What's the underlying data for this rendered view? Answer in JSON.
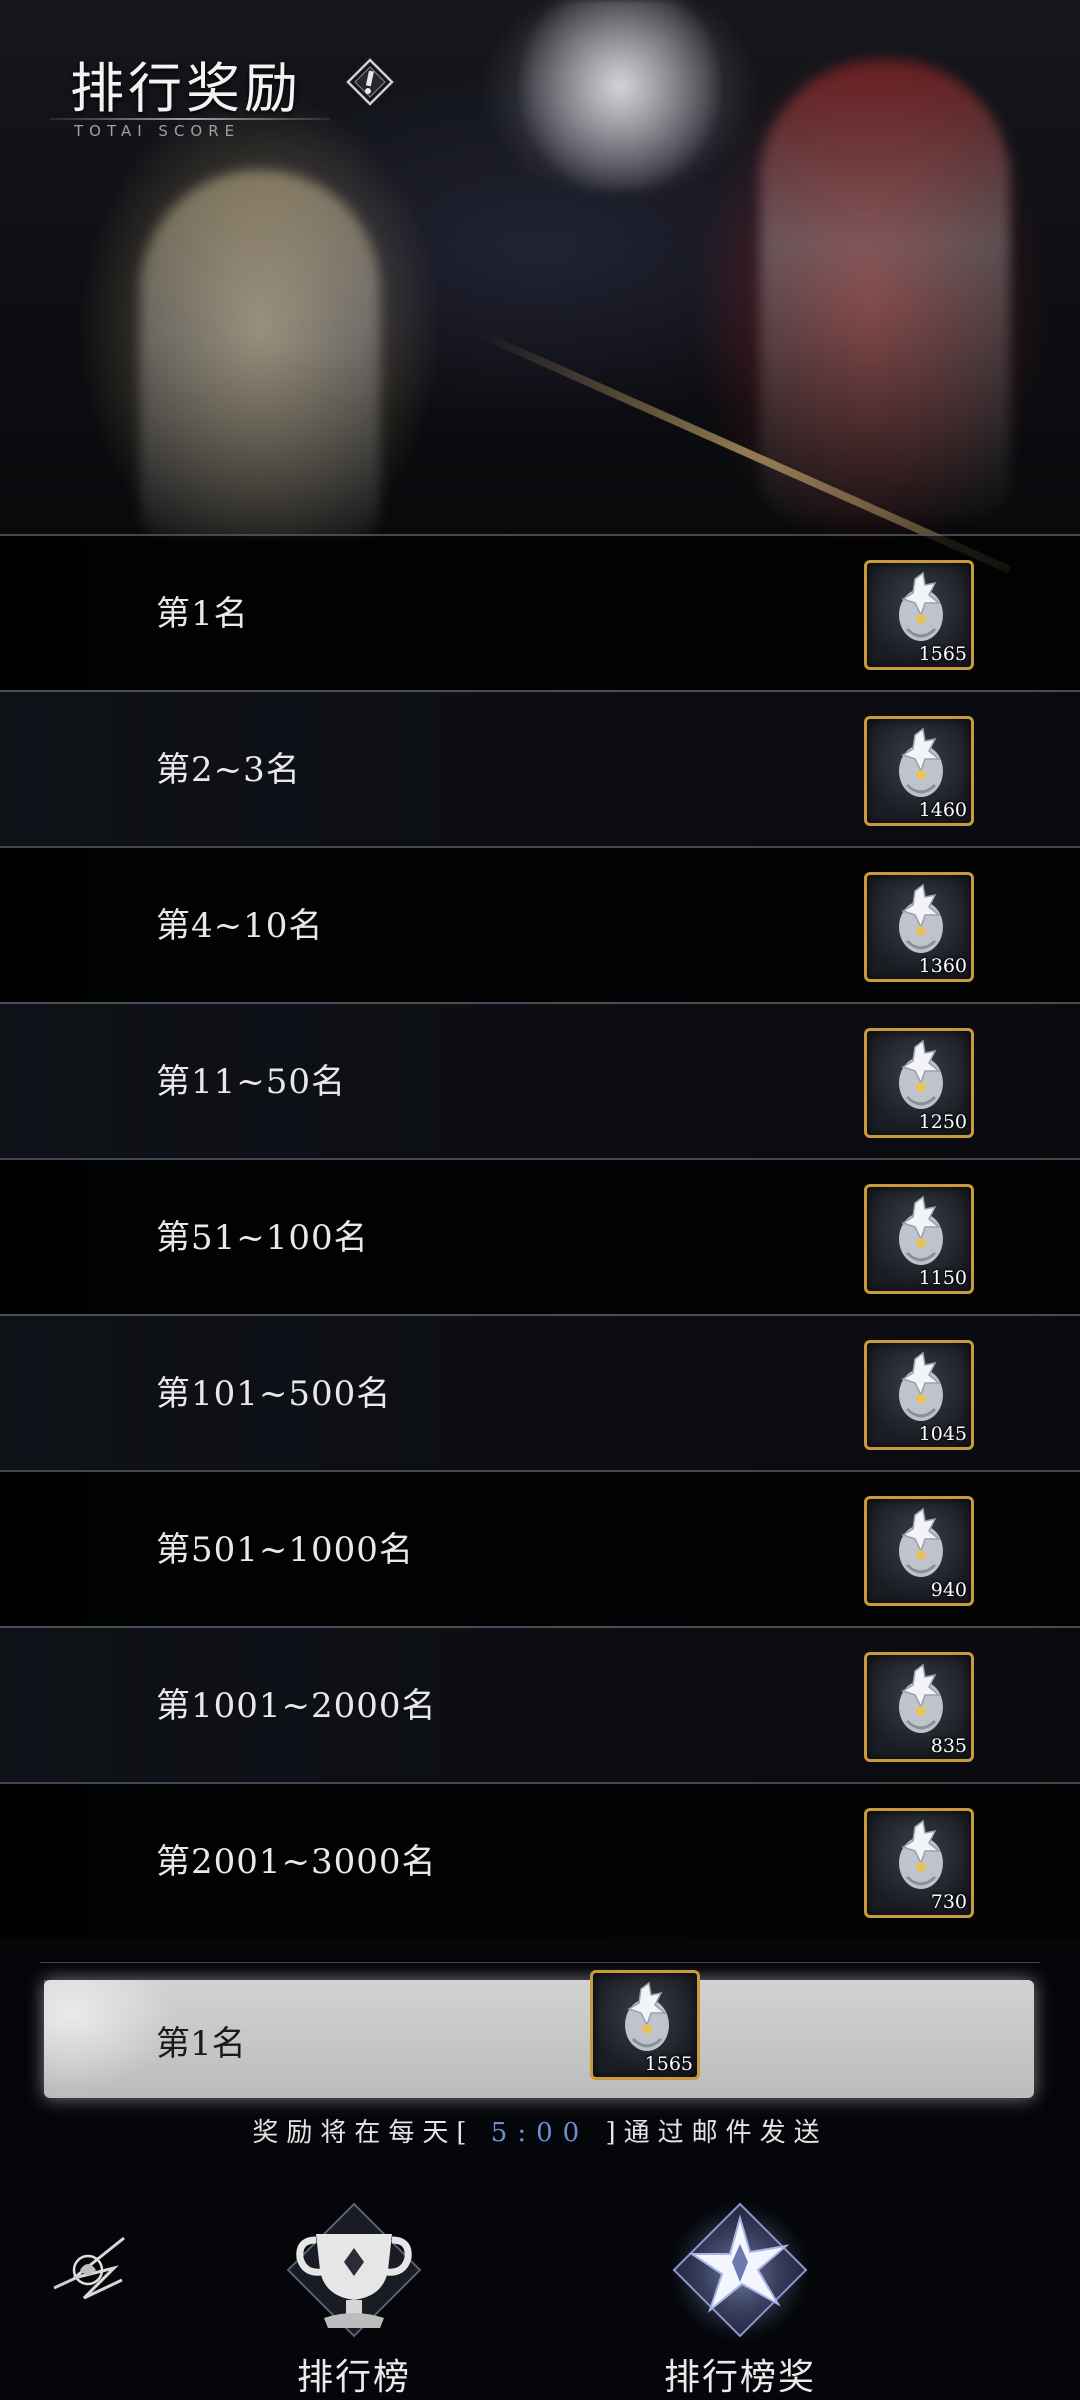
{
  "header": {
    "title": "排行奖励",
    "subtitle": "TOTAI SCORE"
  },
  "rewards": [
    {
      "rank": "第1名",
      "count": "1565"
    },
    {
      "rank": "第2~3名",
      "count": "1460"
    },
    {
      "rank": "第4~10名",
      "count": "1360"
    },
    {
      "rank": "第11~50名",
      "count": "1250"
    },
    {
      "rank": "第51~100名",
      "count": "1150"
    },
    {
      "rank": "第101~500名",
      "count": "1045"
    },
    {
      "rank": "第501~1000名",
      "count": "940"
    },
    {
      "rank": "第1001~2000名",
      "count": "835"
    },
    {
      "rank": "第2001~3000名",
      "count": "730"
    }
  ],
  "my_rank": {
    "rank": "第1名",
    "count": "1565"
  },
  "notice": {
    "before": "奖励将在每天[",
    "time": "5:00",
    "after": "]通过邮件发送"
  },
  "nav": {
    "leaderboard_label": "排行榜",
    "rewards_label": "排行榜奖"
  },
  "colors": {
    "item_border": "#c99a3a",
    "time_text": "#6c8fcf",
    "highlight_bar": "#c8c8c8"
  },
  "icons": {
    "reward_item": "dragon-crystal-icon",
    "leaderboard_tab": "trophy-icon",
    "rewards_tab": "star-icon",
    "back": "rose-wing-icon",
    "info": "exclamation-icon"
  }
}
